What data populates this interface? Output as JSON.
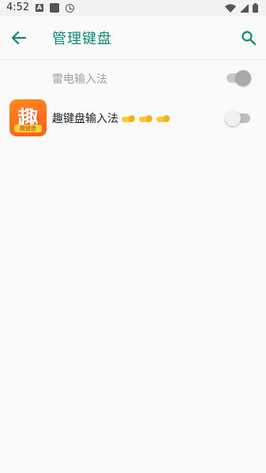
{
  "status_bar": {
    "time": "4:52",
    "left_icons": [
      "a-notification-icon",
      "square-app-icon",
      "clock-icon"
    ],
    "right_icons": [
      "wifi-icon",
      "signal-icon",
      "battery-icon"
    ],
    "a_icon_letter": "A"
  },
  "app_bar": {
    "title": "管理键盘",
    "back_icon": "arrow-left-icon",
    "search_icon": "search-icon",
    "accent_color": "#14877b"
  },
  "keyboards": [
    {
      "label": "雷电输入法",
      "enabled": true,
      "disabled_row": true
    },
    {
      "label": "趣键盘输入法",
      "emoji": "pointing-left-hands x3",
      "enabled": false,
      "icon": {
        "glyph": "趣",
        "band_text": "趣键盘"
      }
    }
  ]
}
